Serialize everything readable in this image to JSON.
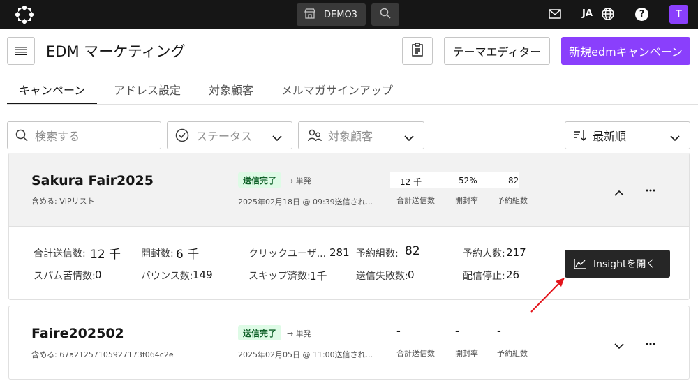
{
  "topbar": {
    "store_name": "DEMO3",
    "language": "JA",
    "help_label": "?",
    "avatar_initial": "T"
  },
  "header": {
    "title": "EDM マーケティング",
    "theme_editor_label": "テーマエディター",
    "new_campaign_label": "新規edmキャンペーン"
  },
  "tabs": [
    {
      "label": "キャンペーン",
      "active": true
    },
    {
      "label": "アドレス設定",
      "active": false
    },
    {
      "label": "対象顧客",
      "active": false
    },
    {
      "label": "メルマガサインアップ",
      "active": false
    }
  ],
  "filters": {
    "search_placeholder": "検索する",
    "status_placeholder": "ステータス",
    "audience_placeholder": "対象顧客",
    "sort_label": "最新順"
  },
  "campaigns": [
    {
      "name": "Sakura Fair2025",
      "includes": "含める: VIPリスト",
      "status": "送信完了",
      "type": "→ 単発",
      "sent_at": "2025年02月18日 @ 09:39送信され...",
      "metrics": [
        {
          "value": "12 千",
          "label": "合計送信数"
        },
        {
          "value": "52%",
          "label": "開封率"
        },
        {
          "value": "82",
          "label": "予約組数"
        }
      ],
      "expanded": true,
      "details": {
        "total_sent_label": "合計送信数:",
        "total_sent": "12 千",
        "opens_label": "開封数:",
        "opens": "6 千",
        "click_users_label": "クリックユーザ...",
        "click_users": "281",
        "reservations_label": "予約組数:",
        "reservations": "82",
        "reserved_people_label": "予約人数:",
        "reserved_people": "217",
        "spam_label": "スパム苦情数:",
        "spam": "0",
        "bounce_label": "バウンス数:",
        "bounce": "149",
        "skipped_label": "スキップ済数:",
        "skipped": "1千",
        "failed_label": "送信失敗数:",
        "failed": "0",
        "unsub_label": "配信停止:",
        "unsub": "26"
      },
      "insight_label": "Insightを開く"
    },
    {
      "name": "Faire202502",
      "includes": "含める: 67a21257105927173f064c2e",
      "status": "送信完了",
      "type": "→ 単発",
      "sent_at": "2025年02月05日 @ 11:00送信され...",
      "metrics": [
        {
          "value": "-",
          "label": "合計送信数"
        },
        {
          "value": "-",
          "label": "開封率"
        },
        {
          "value": "-",
          "label": "予約組数"
        }
      ],
      "expanded": false
    }
  ],
  "colors": {
    "accent": "#8a3ffc",
    "topbar": "#161616",
    "success_bg": "#defbe6",
    "success_text": "#0e6027",
    "annotation_arrow": "#e3141b"
  }
}
